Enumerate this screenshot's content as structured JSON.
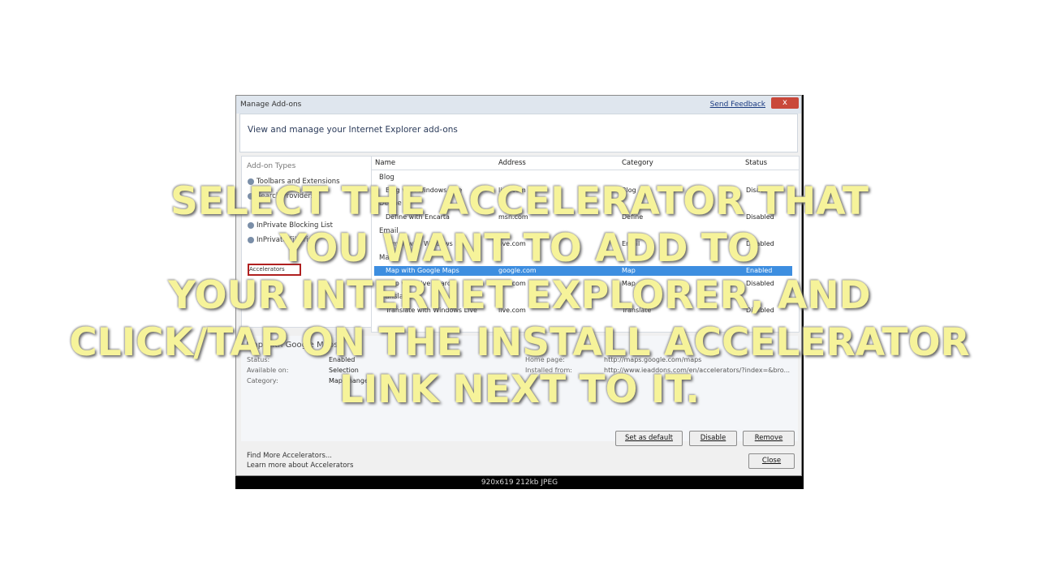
{
  "window": {
    "title": "Manage Add-ons",
    "feedback_link": "Send Feedback",
    "close_glyph": "x",
    "header_text": "View and manage your Internet Explorer add-ons"
  },
  "addon_types": {
    "header": "Add-on Types",
    "items": [
      "Toolbars and Extensions",
      "Search Providers",
      "Accelerators",
      "InPrivate Blocking List",
      "InPrivate Filtering"
    ]
  },
  "list": {
    "columns": [
      "Name",
      "Address",
      "Category",
      "Status"
    ],
    "groups": [
      "Blog",
      "Define",
      "Email",
      "Map",
      "Translate"
    ],
    "rows": [
      {
        "name": "Blog with Windows Live",
        "address": "live.com",
        "category": "Blog",
        "status": "Disabled"
      },
      {
        "name": "Define with Encarta",
        "address": "msn.com",
        "category": "Define",
        "status": "Disabled"
      },
      {
        "name": "E-mail with Windows Live",
        "address": "live.com",
        "category": "Email",
        "status": "Disabled"
      },
      {
        "name": "Map with Google Maps",
        "address": "google.com",
        "category": "Map",
        "status": "Enabled"
      },
      {
        "name": "Map with Live Search",
        "address": "live.com",
        "category": "Map",
        "status": "Disabled"
      },
      {
        "name": "Translate with Windows Live",
        "address": "live.com",
        "category": "Translate",
        "status": "Disabled"
      }
    ]
  },
  "details": {
    "title": "Map with Google Maps",
    "labels": [
      "Status:",
      "Available on:",
      "Category:"
    ],
    "values": [
      "Enabled",
      "Selection",
      "Map change"
    ],
    "labels_right": [
      "Home page:",
      "Installed from:"
    ],
    "values_right": [
      "http://maps.google.com/maps",
      "http://www.ieaddons.com/en/accelerators/?index=&bro..."
    ]
  },
  "buttons": {
    "set_default": "Set as default",
    "disable": "Disable",
    "remove": "Remove",
    "close": "Close"
  },
  "footer": {
    "find_more": "Find More Accelerators...",
    "learn_more": "Learn more about Accelerators"
  },
  "image_status": "920x619  212kb  JPEG",
  "overlay": {
    "lines": [
      "SELECT THE ACCELERATOR THAT",
      "YOU WANT TO ADD TO",
      "YOUR INTERNET EXPLORER, AND",
      "CLICK/TAP ON THE INSTALL ACCELERATOR",
      "LINK NEXT TO IT."
    ]
  }
}
